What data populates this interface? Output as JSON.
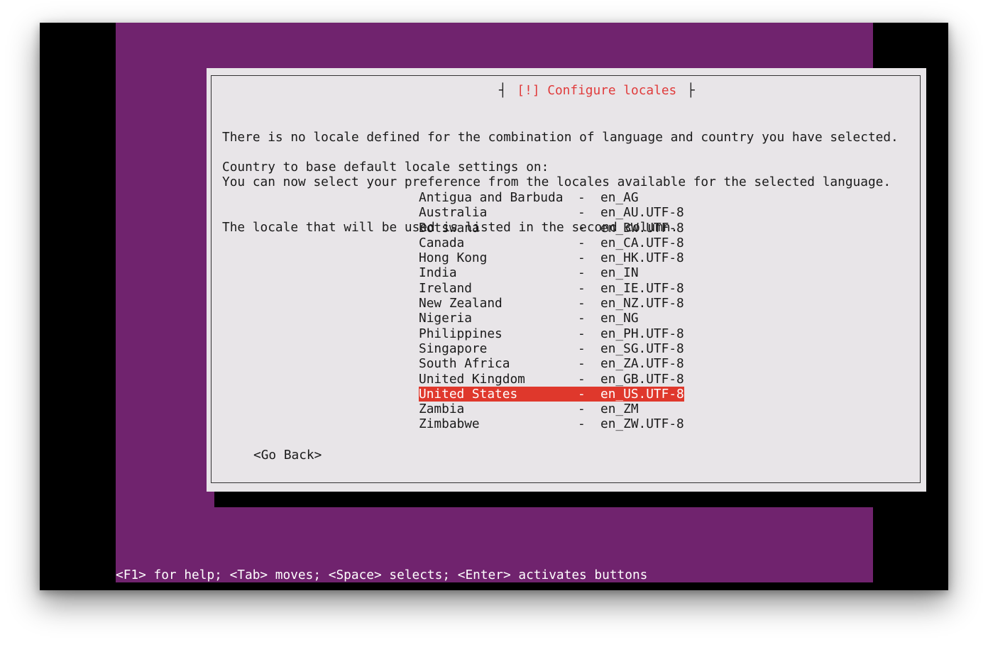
{
  "dialog": {
    "title": "[!] Configure locales",
    "message_lines": [
      "There is no locale defined for the combination of language and country you have selected.",
      "You can now select your preference from the locales available for the selected language.",
      "The locale that will be used is listed in the second column."
    ],
    "prompt": "Country to base default locale settings on:",
    "separator": "-",
    "options": [
      {
        "country": "Antigua and Barbuda",
        "locale": "en_AG"
      },
      {
        "country": "Australia",
        "locale": "en_AU.UTF-8"
      },
      {
        "country": "Botswana",
        "locale": "en_BW.UTF-8"
      },
      {
        "country": "Canada",
        "locale": "en_CA.UTF-8"
      },
      {
        "country": "Hong Kong",
        "locale": "en_HK.UTF-8"
      },
      {
        "country": "India",
        "locale": "en_IN"
      },
      {
        "country": "Ireland",
        "locale": "en_IE.UTF-8"
      },
      {
        "country": "New Zealand",
        "locale": "en_NZ.UTF-8"
      },
      {
        "country": "Nigeria",
        "locale": "en_NG"
      },
      {
        "country": "Philippines",
        "locale": "en_PH.UTF-8"
      },
      {
        "country": "Singapore",
        "locale": "en_SG.UTF-8"
      },
      {
        "country": "South Africa",
        "locale": "en_ZA.UTF-8"
      },
      {
        "country": "United Kingdom",
        "locale": "en_GB.UTF-8"
      },
      {
        "country": "United States",
        "locale": "en_US.UTF-8"
      },
      {
        "country": "Zambia",
        "locale": "en_ZM"
      },
      {
        "country": "Zimbabwe",
        "locale": "en_ZW.UTF-8"
      }
    ],
    "selected_country": "United States",
    "go_back_label": "<Go Back>"
  },
  "statusbar": {
    "text": "<F1> for help; <Tab> moves; <Space> selects; <Enter> activates buttons"
  },
  "colors": {
    "background": "#70236e",
    "dialog": "#e8e5e8",
    "highlight": "#df382c",
    "title": "#e03b3b"
  }
}
